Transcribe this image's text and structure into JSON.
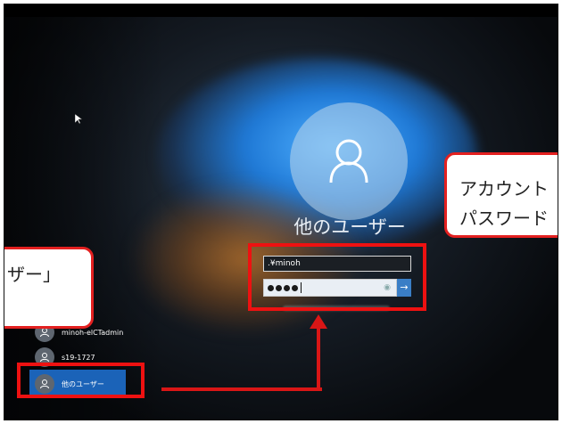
{
  "login": {
    "display_name": "他のユーザー",
    "username_value": ".¥minoh",
    "password_masked_count": 4
  },
  "user_list": [
    {
      "label": "minoh-elCTadmin"
    },
    {
      "label": "s19-1727"
    },
    {
      "label": "他のユーザー",
      "selected": true
    }
  ],
  "callouts": {
    "right_line1": "アカウント",
    "right_line2": "パスワード",
    "left_line1": "ザー」"
  },
  "colors": {
    "annotation_red": "#ee1111",
    "selected_tile_blue": "#1b63b8",
    "submit_blue": "#3a7ec6"
  }
}
